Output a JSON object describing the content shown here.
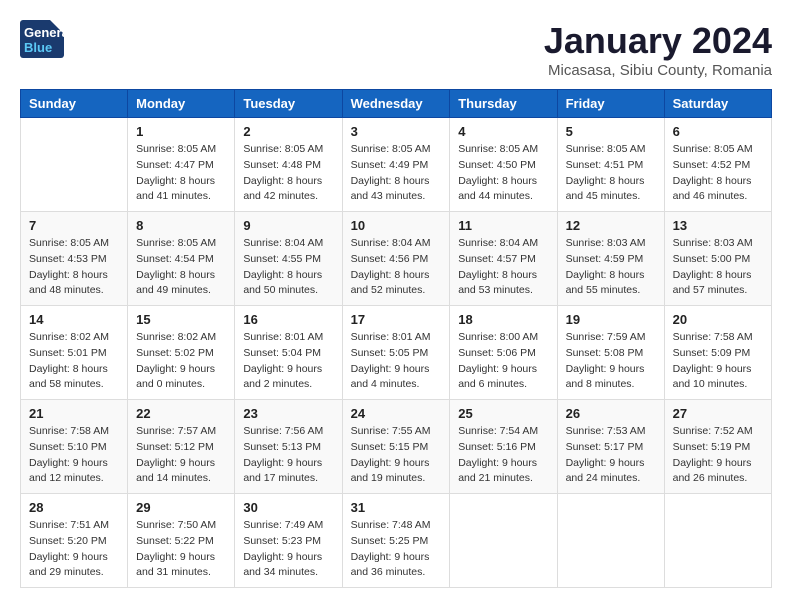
{
  "logo": {
    "line1": "General",
    "line2": "Blue"
  },
  "title": "January 2024",
  "subtitle": "Micasasa, Sibiu County, Romania",
  "days_of_week": [
    "Sunday",
    "Monday",
    "Tuesday",
    "Wednesday",
    "Thursday",
    "Friday",
    "Saturday"
  ],
  "weeks": [
    [
      {
        "day": "",
        "sunrise": "",
        "sunset": "",
        "daylight": ""
      },
      {
        "day": "1",
        "sunrise": "Sunrise: 8:05 AM",
        "sunset": "Sunset: 4:47 PM",
        "daylight": "Daylight: 8 hours and 41 minutes."
      },
      {
        "day": "2",
        "sunrise": "Sunrise: 8:05 AM",
        "sunset": "Sunset: 4:48 PM",
        "daylight": "Daylight: 8 hours and 42 minutes."
      },
      {
        "day": "3",
        "sunrise": "Sunrise: 8:05 AM",
        "sunset": "Sunset: 4:49 PM",
        "daylight": "Daylight: 8 hours and 43 minutes."
      },
      {
        "day": "4",
        "sunrise": "Sunrise: 8:05 AM",
        "sunset": "Sunset: 4:50 PM",
        "daylight": "Daylight: 8 hours and 44 minutes."
      },
      {
        "day": "5",
        "sunrise": "Sunrise: 8:05 AM",
        "sunset": "Sunset: 4:51 PM",
        "daylight": "Daylight: 8 hours and 45 minutes."
      },
      {
        "day": "6",
        "sunrise": "Sunrise: 8:05 AM",
        "sunset": "Sunset: 4:52 PM",
        "daylight": "Daylight: 8 hours and 46 minutes."
      }
    ],
    [
      {
        "day": "7",
        "sunrise": "Sunrise: 8:05 AM",
        "sunset": "Sunset: 4:53 PM",
        "daylight": "Daylight: 8 hours and 48 minutes."
      },
      {
        "day": "8",
        "sunrise": "Sunrise: 8:05 AM",
        "sunset": "Sunset: 4:54 PM",
        "daylight": "Daylight: 8 hours and 49 minutes."
      },
      {
        "day": "9",
        "sunrise": "Sunrise: 8:04 AM",
        "sunset": "Sunset: 4:55 PM",
        "daylight": "Daylight: 8 hours and 50 minutes."
      },
      {
        "day": "10",
        "sunrise": "Sunrise: 8:04 AM",
        "sunset": "Sunset: 4:56 PM",
        "daylight": "Daylight: 8 hours and 52 minutes."
      },
      {
        "day": "11",
        "sunrise": "Sunrise: 8:04 AM",
        "sunset": "Sunset: 4:57 PM",
        "daylight": "Daylight: 8 hours and 53 minutes."
      },
      {
        "day": "12",
        "sunrise": "Sunrise: 8:03 AM",
        "sunset": "Sunset: 4:59 PM",
        "daylight": "Daylight: 8 hours and 55 minutes."
      },
      {
        "day": "13",
        "sunrise": "Sunrise: 8:03 AM",
        "sunset": "Sunset: 5:00 PM",
        "daylight": "Daylight: 8 hours and 57 minutes."
      }
    ],
    [
      {
        "day": "14",
        "sunrise": "Sunrise: 8:02 AM",
        "sunset": "Sunset: 5:01 PM",
        "daylight": "Daylight: 8 hours and 58 minutes."
      },
      {
        "day": "15",
        "sunrise": "Sunrise: 8:02 AM",
        "sunset": "Sunset: 5:02 PM",
        "daylight": "Daylight: 9 hours and 0 minutes."
      },
      {
        "day": "16",
        "sunrise": "Sunrise: 8:01 AM",
        "sunset": "Sunset: 5:04 PM",
        "daylight": "Daylight: 9 hours and 2 minutes."
      },
      {
        "day": "17",
        "sunrise": "Sunrise: 8:01 AM",
        "sunset": "Sunset: 5:05 PM",
        "daylight": "Daylight: 9 hours and 4 minutes."
      },
      {
        "day": "18",
        "sunrise": "Sunrise: 8:00 AM",
        "sunset": "Sunset: 5:06 PM",
        "daylight": "Daylight: 9 hours and 6 minutes."
      },
      {
        "day": "19",
        "sunrise": "Sunrise: 7:59 AM",
        "sunset": "Sunset: 5:08 PM",
        "daylight": "Daylight: 9 hours and 8 minutes."
      },
      {
        "day": "20",
        "sunrise": "Sunrise: 7:58 AM",
        "sunset": "Sunset: 5:09 PM",
        "daylight": "Daylight: 9 hours and 10 minutes."
      }
    ],
    [
      {
        "day": "21",
        "sunrise": "Sunrise: 7:58 AM",
        "sunset": "Sunset: 5:10 PM",
        "daylight": "Daylight: 9 hours and 12 minutes."
      },
      {
        "day": "22",
        "sunrise": "Sunrise: 7:57 AM",
        "sunset": "Sunset: 5:12 PM",
        "daylight": "Daylight: 9 hours and 14 minutes."
      },
      {
        "day": "23",
        "sunrise": "Sunrise: 7:56 AM",
        "sunset": "Sunset: 5:13 PM",
        "daylight": "Daylight: 9 hours and 17 minutes."
      },
      {
        "day": "24",
        "sunrise": "Sunrise: 7:55 AM",
        "sunset": "Sunset: 5:15 PM",
        "daylight": "Daylight: 9 hours and 19 minutes."
      },
      {
        "day": "25",
        "sunrise": "Sunrise: 7:54 AM",
        "sunset": "Sunset: 5:16 PM",
        "daylight": "Daylight: 9 hours and 21 minutes."
      },
      {
        "day": "26",
        "sunrise": "Sunrise: 7:53 AM",
        "sunset": "Sunset: 5:17 PM",
        "daylight": "Daylight: 9 hours and 24 minutes."
      },
      {
        "day": "27",
        "sunrise": "Sunrise: 7:52 AM",
        "sunset": "Sunset: 5:19 PM",
        "daylight": "Daylight: 9 hours and 26 minutes."
      }
    ],
    [
      {
        "day": "28",
        "sunrise": "Sunrise: 7:51 AM",
        "sunset": "Sunset: 5:20 PM",
        "daylight": "Daylight: 9 hours and 29 minutes."
      },
      {
        "day": "29",
        "sunrise": "Sunrise: 7:50 AM",
        "sunset": "Sunset: 5:22 PM",
        "daylight": "Daylight: 9 hours and 31 minutes."
      },
      {
        "day": "30",
        "sunrise": "Sunrise: 7:49 AM",
        "sunset": "Sunset: 5:23 PM",
        "daylight": "Daylight: 9 hours and 34 minutes."
      },
      {
        "day": "31",
        "sunrise": "Sunrise: 7:48 AM",
        "sunset": "Sunset: 5:25 PM",
        "daylight": "Daylight: 9 hours and 36 minutes."
      },
      {
        "day": "",
        "sunrise": "",
        "sunset": "",
        "daylight": ""
      },
      {
        "day": "",
        "sunrise": "",
        "sunset": "",
        "daylight": ""
      },
      {
        "day": "",
        "sunrise": "",
        "sunset": "",
        "daylight": ""
      }
    ]
  ]
}
